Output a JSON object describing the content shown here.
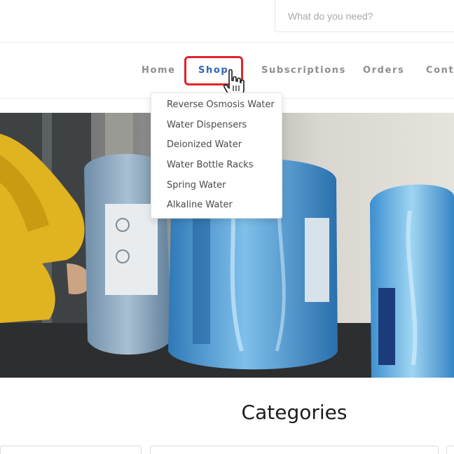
{
  "search": {
    "placeholder": "What do you need?"
  },
  "nav": {
    "items": [
      {
        "label": "Home"
      },
      {
        "label": "Shop"
      },
      {
        "label": "Subscriptions"
      },
      {
        "label": "Orders"
      },
      {
        "label": "Conta"
      }
    ],
    "active": "Shop"
  },
  "shop_menu": {
    "items": [
      {
        "label": "Reverse Osmosis Water"
      },
      {
        "label": "Water Dispensers"
      },
      {
        "label": "Deionized Water"
      },
      {
        "label": "Water Bottle Racks"
      },
      {
        "label": "Spring Water"
      },
      {
        "label": "Alkaline Water"
      }
    ]
  },
  "categories": {
    "title": "Categories"
  },
  "colors": {
    "accent": "#2f66b3",
    "nav_text": "#8e8e8e",
    "highlight": "#e2242b"
  },
  "icons": {
    "cursor": "hand-pointer-icon"
  }
}
